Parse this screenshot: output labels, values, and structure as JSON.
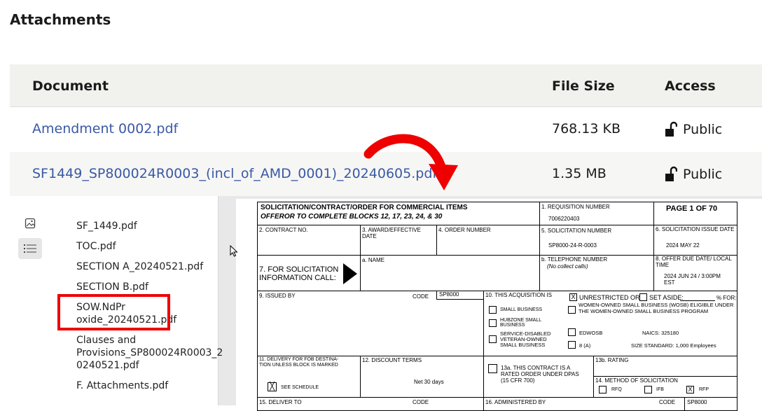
{
  "page_title": "Attachments",
  "table": {
    "headers": {
      "document": "Document",
      "file_size": "File Size",
      "access": "Access"
    },
    "rows": [
      {
        "document": "Amendment 0002.pdf",
        "size": "768.13 KB",
        "access": "Public"
      },
      {
        "document": "SF1449_SP800024R0003_(incl_of_AMD_0001)_20240605.pdf",
        "size": "1.35 MB",
        "access": "Public"
      }
    ]
  },
  "viewer": {
    "sidebar_icons": [
      "image-icon",
      "list-icon"
    ],
    "toc_items": [
      "SF_1449.pdf",
      "TOC.pdf",
      "SECTION A_20240521.pdf",
      "SECTION B.pdf",
      "SOW.NdPr oxide_20240521.pdf",
      "Clauses and Provisions_SP800024R0003_2 0240521.pdf",
      "F. Attachments.pdf"
    ],
    "form": {
      "header1": "SOLICITATION/CONTRACT/ORDER FOR COMMERCIAL ITEMS",
      "header2": "OFFEROR TO COMPLETE BLOCKS 12, 17, 23, 24, & 30",
      "req_label": "1. REQUISITION NUMBER",
      "req_value": "7006220403",
      "page_label": "PAGE 1 OF 70",
      "contract_no": "2. CONTRACT NO.",
      "award_date": "3. AWARD/EFFECTIVE DATE",
      "order_no": "4. ORDER NUMBER",
      "solicitation_no_label": "5. SOLICITATION NUMBER",
      "solicitation_no_value": "SP8000-24-R-0003",
      "issue_date_label": "6. SOLICITATION ISSUE DATE",
      "issue_date_value": "2024 MAY 22",
      "info_call": "7. FOR SOLICITATION INFORMATION CALL:",
      "name_label": "a. NAME",
      "tel_label": "b. TELEPHONE NUMBER",
      "tel_note": "(No collect calls)",
      "due_label": "8. OFFER DUE DATE/ LOCAL TIME",
      "due_value": "2024 JUN 24 / 3:00PM EST",
      "issued_by": "9. ISSUED BY",
      "code_label": "CODE",
      "code_value": "SP8000",
      "acq_label": "10. THIS ACQUISITION IS",
      "unrestricted": "UNRESTRICTED OR",
      "set_aside": "SET ASIDE:",
      "pct_for": "% FOR:",
      "small_business": "SMALL BUSINESS",
      "hubzone": "HUBZONE SMALL BUSINESS",
      "sdvosb": "SERVICE-DISABLED VETERAN-OWNED SMALL BUSINESS",
      "wosb": "WOMEN-OWNED SMALL BUSINESS (WOSB) ELIGIBLE UNDER THE WOMEN-OWNED SMALL BUSINESS PROGRAM",
      "edwosb": "EDWOSB",
      "eight_a": "8 (A)",
      "naics": "NAICS:  325180",
      "size_std": "SIZE STANDARD: 1,000 Employees",
      "delivery": "11. DELIVERY FOR FOB DESTINA- TION UNLESS BLOCK IS MARKED",
      "see_schedule": "SEE SCHEDULE",
      "discount": "12. DISCOUNT TERMS",
      "net30": "Net 30 days",
      "rated": "13a. THIS CONTRACT IS A RATED ORDER UNDER DPAS (15 CFR 700)",
      "rating": "13b. RATING",
      "method": "14. METHOD OF SOLICITATION",
      "rfq": "RFQ",
      "ifb": "IFB",
      "rfp": "RFP",
      "deliver_to": "15. DELIVER TO",
      "administered": "16. ADMINISTERED BY",
      "code_value2": "SP8000"
    }
  },
  "colors": {
    "link": "#3a58a5",
    "highlight": "#e00000",
    "arrow": "#e00000"
  }
}
